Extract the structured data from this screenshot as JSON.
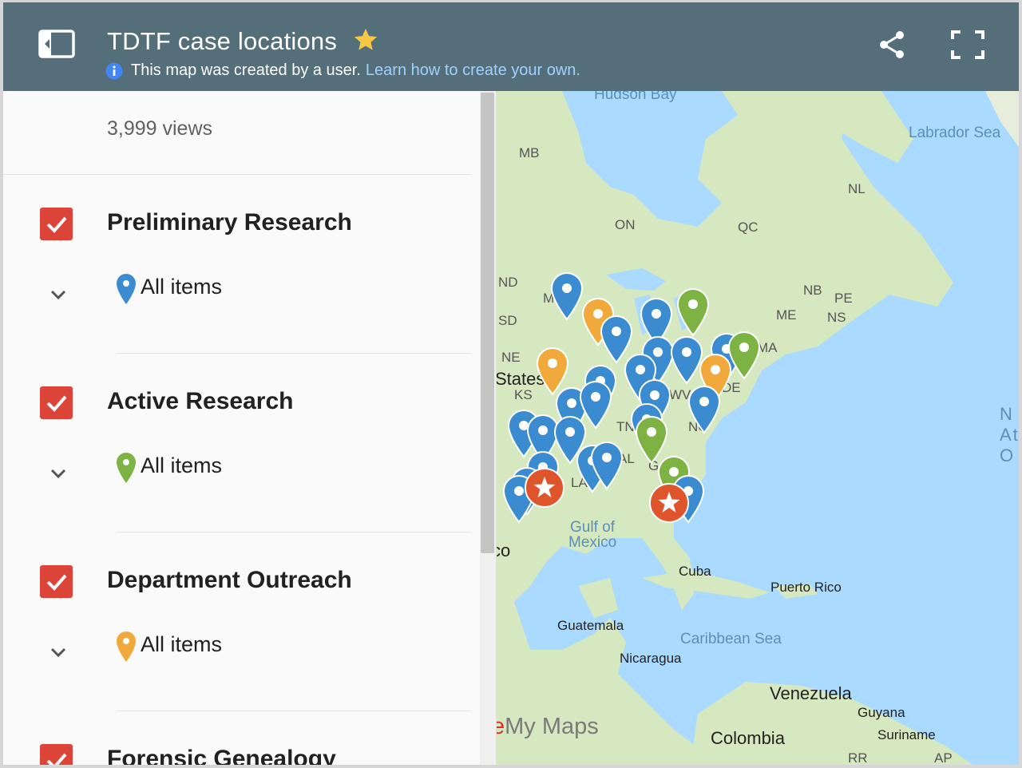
{
  "header": {
    "title": "TDTF case locations",
    "subtitle_text": "This map was created by a user.",
    "subtitle_link": "Learn how to create your own."
  },
  "sidebar": {
    "views": "3,999 views",
    "layers": [
      {
        "title": "Preliminary Research",
        "item_label": "All items",
        "pin_color": "#3a8bd0"
      },
      {
        "title": "Active Research",
        "item_label": "All items",
        "pin_color": "#7cb342"
      },
      {
        "title": "Department Outreach",
        "item_label": "All items",
        "pin_color": "#f2a93b"
      },
      {
        "title": "Forensic Genealogy"
      }
    ]
  },
  "map": {
    "labels": {
      "hudson": "Hudson Bay",
      "labrador": "Labrador Sea",
      "mb": "MB",
      "nl": "NL",
      "on": "ON",
      "qc": "QC",
      "nb": "NB",
      "pe": "PE",
      "ns": "NS",
      "me": "ME",
      "nd": "ND",
      "sd": "SD",
      "ne": "NE",
      "states": "States",
      "ks": "KS",
      "mi": "MI",
      "wv": "WV",
      "nc": "NC",
      "tn": "TN",
      "al": "AL",
      "la": "LA",
      "ga": "G",
      "de": "DE",
      "ma": "MA",
      "gulf": "Gulf of",
      "mexico": "Mexico",
      "co": "co",
      "cuba": "Cuba",
      "puerto_rico": "Puerto Rico",
      "guatemala": "Guatemala",
      "caribbean": "Caribbean Sea",
      "nicaragua": "Nicaragua",
      "venezuela": "Venezuela",
      "guyana": "Guyana",
      "suriname": "Suriname",
      "colombia": "Colombia",
      "rr": "RR",
      "ap": "AP",
      "north_atlantic": "N At O"
    },
    "branding_prefix": "e",
    "branding": "My Maps"
  },
  "colors": {
    "header_bg": "#546e7a",
    "check_red": "#db4437",
    "pin_blue": "#3a8bd0",
    "pin_green": "#7cb342",
    "pin_orange": "#f2a93b",
    "star_marker": "#e0542b",
    "water": "#aadaff",
    "land": "#cfe3b6"
  },
  "icons": {
    "toggle": "sidebar-toggle-icon",
    "star": "star-icon",
    "info": "info-icon",
    "share": "share-icon",
    "fullscreen": "fullscreen-icon"
  }
}
